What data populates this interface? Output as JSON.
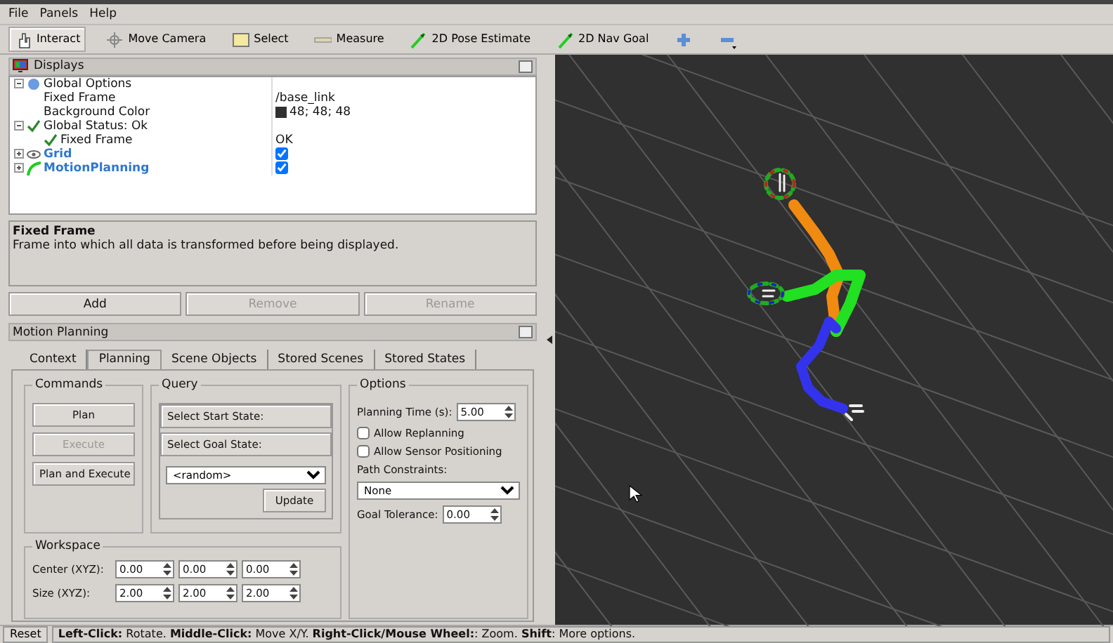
{
  "menu": [
    "File",
    "Panels",
    "Help"
  ],
  "toolbar": [
    {
      "label": "Interact",
      "kind": "hand",
      "selected": true
    },
    {
      "label": "Move Camera",
      "kind": "move",
      "selected": false
    },
    {
      "label": "Select",
      "kind": "select",
      "selected": false
    },
    {
      "label": "Measure",
      "kind": "ruler",
      "selected": false
    },
    {
      "label": "2D Pose Estimate",
      "kind": "arrow",
      "selected": false
    },
    {
      "label": "2D Nav Goal",
      "kind": "arrow",
      "selected": false
    },
    {
      "kind": "plus",
      "selected": false
    },
    {
      "kind": "minus",
      "selected": false
    }
  ],
  "displays": {
    "title": "Displays",
    "tree": [
      {
        "label": "Global Options",
        "kind": "globe",
        "expanded": true,
        "children": [
          {
            "label": "Fixed Frame",
            "value": "/base_link"
          },
          {
            "label": "Background Color",
            "value": "48; 48; 48",
            "color": "#303030"
          }
        ]
      },
      {
        "label": "Global Status: Ok",
        "kind": "check",
        "expanded": true,
        "children": [
          {
            "label": "Fixed Frame",
            "kind": "check",
            "value": "OK"
          }
        ]
      },
      {
        "label": "Grid",
        "kind": "eye",
        "expanded": false,
        "checked": true
      },
      {
        "label": "MotionPlanning",
        "kind": "arm",
        "expanded": false,
        "checked": true
      }
    ],
    "description": {
      "title": "Fixed Frame",
      "text": "Frame into which all data is transformed before being displayed."
    },
    "buttons": [
      {
        "label": "Add",
        "disabled": false
      },
      {
        "label": "Remove",
        "disabled": true
      },
      {
        "label": "Rename",
        "disabled": true
      }
    ]
  },
  "motion_planning": {
    "title": "Motion Planning",
    "tabs": [
      {
        "label": "Context",
        "selected": false
      },
      {
        "label": "Planning",
        "selected": true
      },
      {
        "label": "Scene Objects",
        "selected": false
      },
      {
        "label": "Stored Scenes",
        "selected": false
      },
      {
        "label": "Stored States",
        "selected": false
      }
    ],
    "commands": {
      "title": "Commands",
      "buttons": [
        {
          "label": "Plan",
          "disabled": false
        },
        {
          "label": "Execute",
          "disabled": true
        },
        {
          "label": "Plan and Execute",
          "disabled": false
        }
      ]
    },
    "query": {
      "title": "Query",
      "buttons": [
        "Select Start State:",
        "Select Goal State:"
      ],
      "dropdown": "<random>",
      "update": "Update"
    },
    "options": {
      "title": "Options",
      "planning_time_label": "Planning Time (s):",
      "planning_time": "5.00",
      "checkboxes": [
        {
          "label": "Allow Replanning",
          "checked": false
        },
        {
          "label": "Allow Sensor Positioning",
          "checked": false
        }
      ],
      "path_constraints_label": "Path Constraints:",
      "path_constraints": "None",
      "goal_tolerance_label": "Goal Tolerance:",
      "goal_tolerance": "0.00"
    },
    "workspace": {
      "title": "Workspace",
      "rows": [
        {
          "label": "Center (XYZ):",
          "values": [
            "0.00",
            "0.00",
            "0.00"
          ]
        },
        {
          "label": "Size (XYZ):",
          "values": [
            "2.00",
            "2.00",
            "2.00"
          ]
        }
      ]
    }
  },
  "status_bar": {
    "reset": "Reset",
    "text": "**Left-Click:** Rotate. **Middle-Click:** Move X/Y. **Right-Click/Mouse Wheel:**: Zoom. **Shift**: More options."
  }
}
